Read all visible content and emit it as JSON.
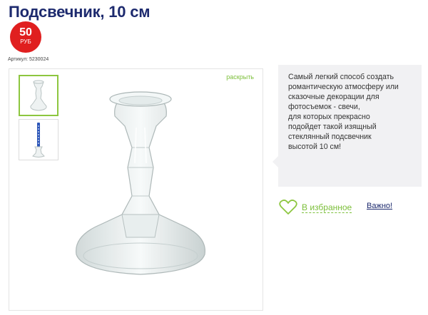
{
  "product": {
    "title": "Подсвечник, 10 см",
    "price_amount": "50",
    "price_currency": "РУБ",
    "sku": "Артикул: 5230024"
  },
  "gallery": {
    "expand_label": "раскрыть",
    "thumbnails": [
      {
        "name": "glass-candlestick",
        "selected": true
      },
      {
        "name": "candlestick-with-candle",
        "selected": false
      }
    ]
  },
  "description": {
    "lines": [
      "Самый легкий способ создать",
      "романтическую атмосферу или",
      "сказочные декорации для",
      "фотосъемок - свечи,",
      "для которых прекрасно",
      "подойдет такой изящный",
      "стеклянный подсвечник",
      "высотой 10 см!"
    ]
  },
  "actions": {
    "favorite_label": "В избранное",
    "favorite_icon": "heart-icon",
    "important_label": "Важно!"
  },
  "colors": {
    "title": "#1d2a6e",
    "badge": "#e01f1f",
    "accent_green": "#7cbf3a",
    "description_bg": "#f1f1f3"
  }
}
